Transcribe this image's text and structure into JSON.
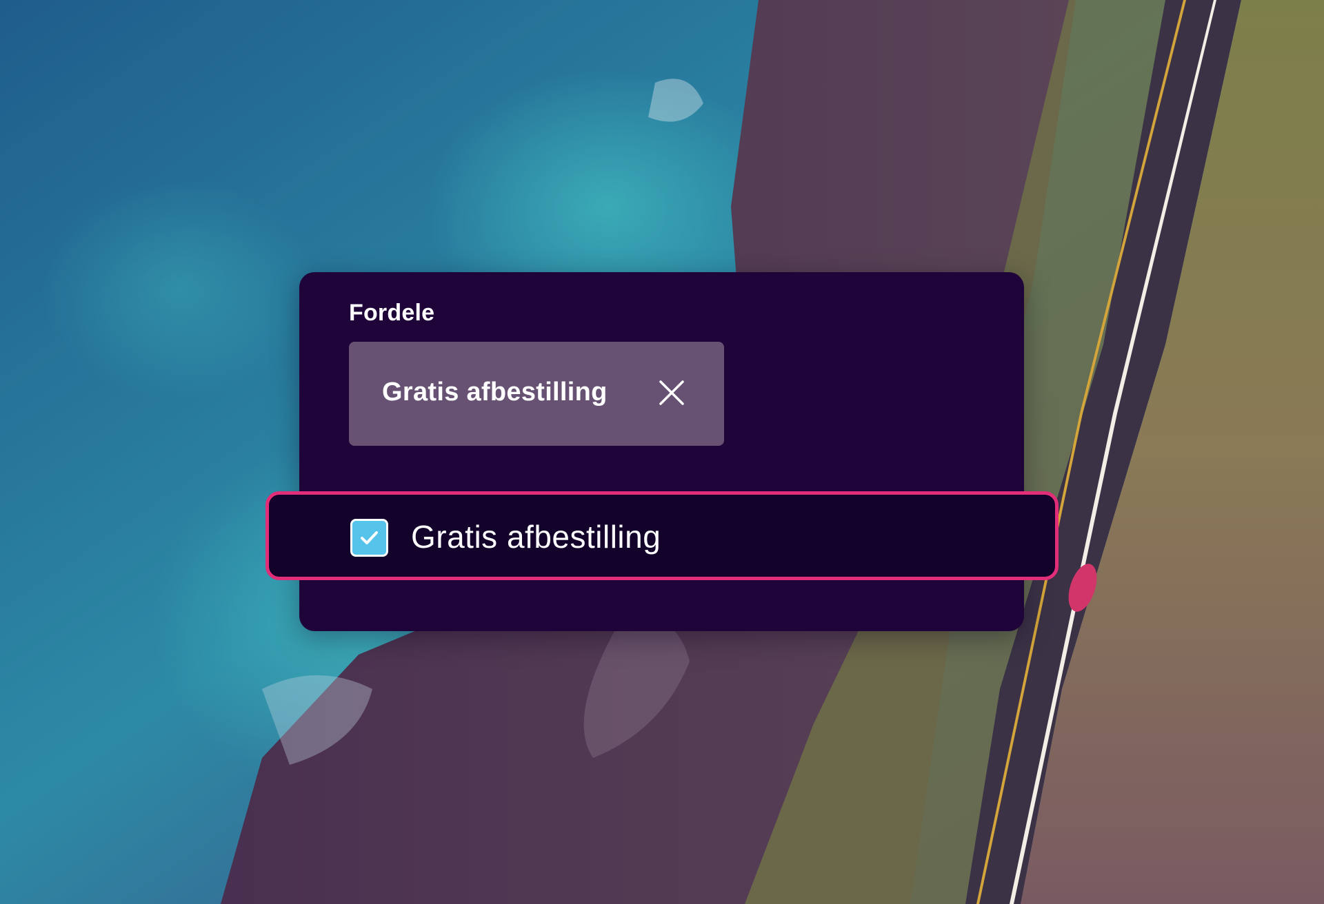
{
  "filter_panel": {
    "label": "Fordele",
    "selected_chip": {
      "label": "Gratis afbestilling",
      "remove_icon": "close-icon"
    },
    "option": {
      "label": "Gratis afbestilling",
      "checked": true,
      "check_icon": "checkmark-icon"
    }
  },
  "colors": {
    "panel_bg": "#1f0439",
    "chip_bg": "#675274",
    "option_border": "#e22d78",
    "checkbox_fill": "#56c3ea"
  }
}
